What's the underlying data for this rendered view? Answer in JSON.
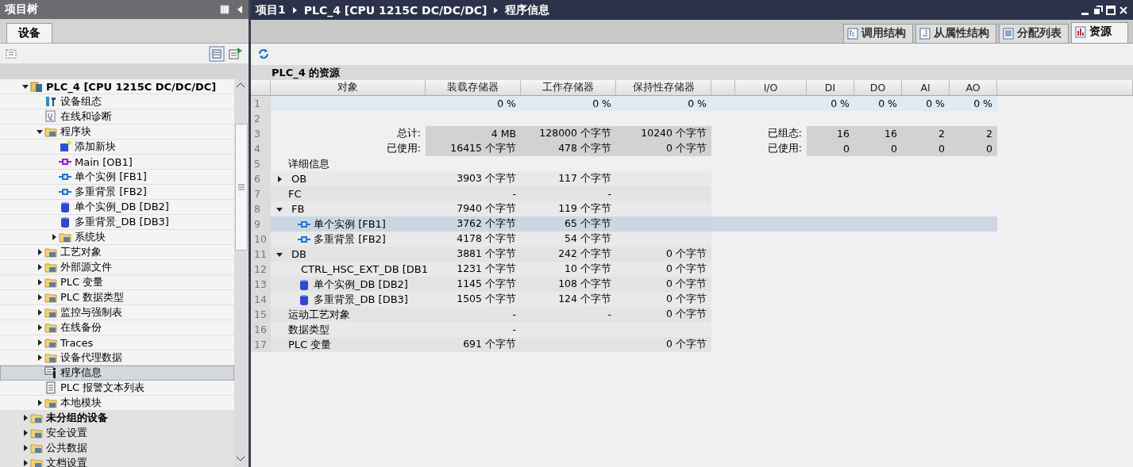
{
  "project_tree": {
    "title": "项目树",
    "tabs": [
      {
        "label": "设备",
        "selected": true
      }
    ],
    "items": [
      {
        "label": "PLC_4 [CPU 1215C DC/DC/DC]",
        "kind": "device",
        "bold": true,
        "expanded": true,
        "selected": false,
        "children": [
          {
            "label": "设备组态",
            "kind": "config",
            "selected": false
          },
          {
            "label": "在线和诊断",
            "kind": "diag",
            "selected": false
          },
          {
            "label": "程序块",
            "kind": "folder",
            "expanded": true,
            "selected": false,
            "children": [
              {
                "label": "添加新块",
                "kind": "add",
                "selected": false
              },
              {
                "label": "Main [OB1]",
                "kind": "ob",
                "selected": false
              },
              {
                "label": "单个实例 [FB1]",
                "kind": "fb",
                "selected": false
              },
              {
                "label": "多重背景 [FB2]",
                "kind": "fb",
                "selected": false
              },
              {
                "label": "单个实例_DB [DB2]",
                "kind": "db",
                "selected": false
              },
              {
                "label": "多重背景_DB [DB3]",
                "kind": "db",
                "selected": false
              },
              {
                "label": "系统块",
                "kind": "folder",
                "expanded": false,
                "selected": false
              }
            ]
          },
          {
            "label": "工艺对象",
            "kind": "folder",
            "expanded": false,
            "selected": false
          },
          {
            "label": "外部源文件",
            "kind": "folder",
            "expanded": false,
            "selected": false
          },
          {
            "label": "PLC 变量",
            "kind": "folder",
            "expanded": false,
            "selected": false
          },
          {
            "label": "PLC 数据类型",
            "kind": "folder",
            "expanded": false,
            "selected": false
          },
          {
            "label": "监控与强制表",
            "kind": "folder",
            "expanded": false,
            "selected": false
          },
          {
            "label": "在线备份",
            "kind": "folder",
            "expanded": false,
            "selected": false
          },
          {
            "label": "Traces",
            "kind": "folder",
            "expanded": false,
            "selected": false
          },
          {
            "label": "设备代理数据",
            "kind": "folder",
            "expanded": false,
            "selected": false
          },
          {
            "label": "程序信息",
            "kind": "info",
            "selected": true
          },
          {
            "label": "PLC 报警文本列表",
            "kind": "doc",
            "selected": false
          },
          {
            "label": "本地模块",
            "kind": "folder",
            "expanded": false,
            "selected": false
          }
        ]
      },
      {
        "label": "未分组的设备",
        "kind": "folder",
        "bold": true,
        "expanded": false,
        "selected": false
      },
      {
        "label": "安全设置",
        "kind": "folder",
        "bold": false,
        "expanded": false,
        "selected": false
      },
      {
        "label": "公共数据",
        "kind": "folder",
        "bold": false,
        "expanded": false,
        "selected": false
      },
      {
        "label": "文档设置",
        "kind": "folder",
        "bold": false,
        "expanded": false,
        "selected": false
      }
    ]
  },
  "editor": {
    "breadcrumb": [
      "项目1",
      "PLC_4 [CPU 1215C DC/DC/DC]",
      "程序信息"
    ],
    "tabs": [
      {
        "label": "调用结构",
        "selected": false
      },
      {
        "label": "从属性结构",
        "selected": false
      },
      {
        "label": "分配列表",
        "selected": false
      },
      {
        "label": "资源",
        "selected": true
      }
    ],
    "section_title": "PLC_4 的资源",
    "table": {
      "columns": [
        "对象",
        "装载存储器",
        "工作存储器",
        "保持性存储器",
        "I/O",
        "DI",
        "DO",
        "AI",
        "AO"
      ],
      "rows": [
        {
          "num": "1",
          "kind": "percent",
          "selected": false,
          "load": "0 %",
          "work": "0 %",
          "retain": "0 %",
          "di": "0 %",
          "do": "0 %",
          "ai": "0 %",
          "ao": "0 %"
        },
        {
          "num": "2",
          "kind": "blank",
          "selected": false
        },
        {
          "num": "3",
          "kind": "summary",
          "selected": false,
          "object": "总计:",
          "load": "4 MB",
          "work": "128000 个字节",
          "retain": "10240 个字节",
          "io": "已组态:",
          "di": "16",
          "do": "16",
          "ai": "2",
          "ao": "2"
        },
        {
          "num": "4",
          "kind": "summary",
          "selected": false,
          "object": "已使用:",
          "load": "16415 个字节",
          "work": "478 个字节",
          "retain": "0 个字节",
          "io": "已使用:",
          "di": "0",
          "do": "0",
          "ai": "0",
          "ao": "0"
        },
        {
          "num": "5",
          "kind": "heading",
          "selected": false,
          "object": "详细信息"
        },
        {
          "num": "6",
          "kind": "group",
          "selected": false,
          "expanded": false,
          "object": "OB",
          "load": "3903 个字节",
          "work": "117 个字节"
        },
        {
          "num": "7",
          "kind": "group",
          "selected": false,
          "object": "FC",
          "load": "-",
          "work": "-"
        },
        {
          "num": "8",
          "kind": "group",
          "selected": false,
          "expanded": true,
          "object": "FB",
          "load": "7940 个字节",
          "work": "119 个字节",
          "children": [
            {
              "num": "9",
              "kind": "fb",
              "selected": true,
              "object": "单个实例 [FB1]",
              "load": "3762 个字节",
              "work": "65 个字节"
            },
            {
              "num": "10",
              "kind": "fb",
              "selected": false,
              "object": "多重背景 [FB2]",
              "load": "4178 个字节",
              "work": "54 个字节"
            }
          ]
        },
        {
          "num": "11",
          "kind": "group",
          "selected": false,
          "expanded": true,
          "object": "DB",
          "load": "3881 个字节",
          "work": "242 个字节",
          "retain": "0 个字节",
          "children": [
            {
              "num": "12",
              "kind": "db_locked",
              "selected": false,
              "object": "CTRL_HSC_EXT_DB [DB1",
              "load": "1231 个字节",
              "work": "10 个字节",
              "retain": "0 个字节"
            },
            {
              "num": "13",
              "kind": "db",
              "selected": false,
              "object": "单个实例_DB [DB2]",
              "load": "1145 个字节",
              "work": "108 个字节",
              "retain": "0 个字节"
            },
            {
              "num": "14",
              "kind": "db",
              "selected": false,
              "object": "多重背景_DB [DB3]",
              "load": "1505 个字节",
              "work": "124 个字节",
              "retain": "0 个字节"
            }
          ]
        },
        {
          "num": "15",
          "kind": "group",
          "selected": false,
          "object": "运动工艺对象",
          "load": "-",
          "work": "-",
          "retain": "0 个字节"
        },
        {
          "num": "16",
          "kind": "group",
          "selected": false,
          "object": "数据类型",
          "load": "-"
        },
        {
          "num": "17",
          "kind": "group",
          "selected": false,
          "object": "PLC 变量",
          "load": "691 个字节",
          "retain": "0 个字节"
        }
      ]
    }
  }
}
